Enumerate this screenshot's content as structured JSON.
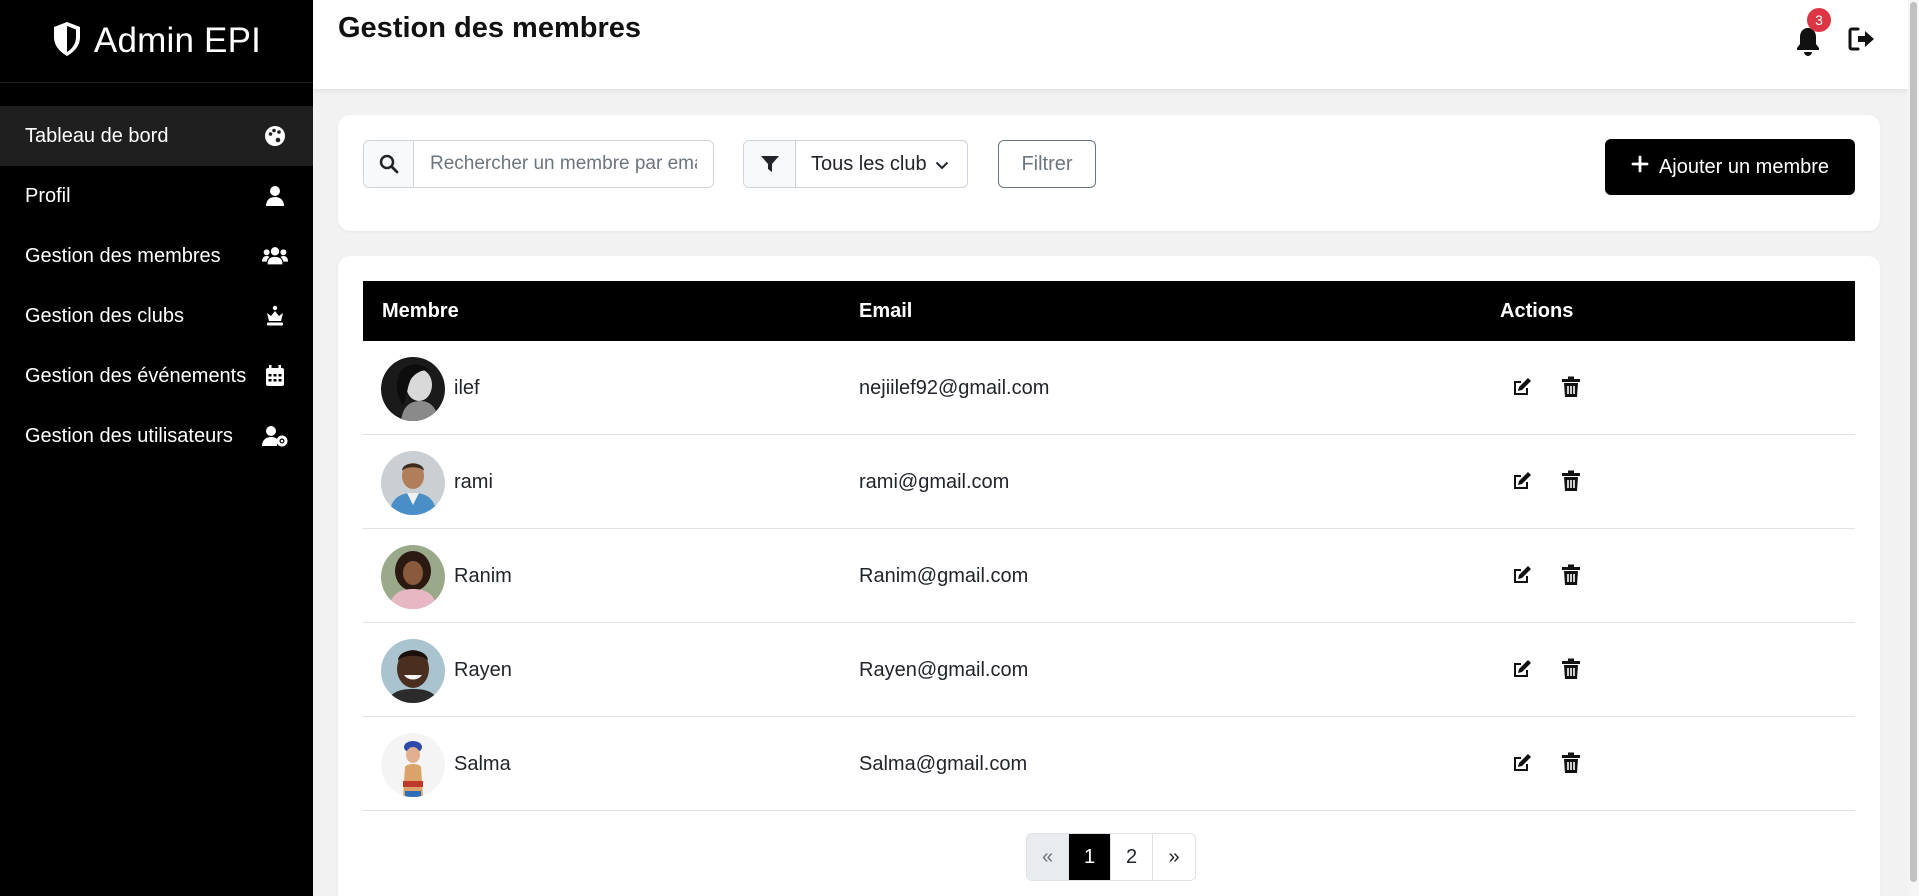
{
  "brand": {
    "title": "Admin EPI"
  },
  "sidebar": {
    "items": [
      {
        "label": "Tableau de bord",
        "icon": "palette-icon",
        "active": true
      },
      {
        "label": "Profil",
        "icon": "user-icon"
      },
      {
        "label": "Gestion des membres",
        "icon": "users-icon"
      },
      {
        "label": "Gestion des clubs",
        "icon": "chess-queen-icon"
      },
      {
        "label": "Gestion des événements",
        "icon": "calendar-icon"
      },
      {
        "label": "Gestion des utilisateurs",
        "icon": "user-gear-icon"
      }
    ]
  },
  "header": {
    "title": "Gestion des membres",
    "notifications_count": "3"
  },
  "toolbar": {
    "search_placeholder": "Rechercher un membre par email",
    "club_select": "Tous les club",
    "filter_label": "Filtrer",
    "add_label": "Ajouter un membre"
  },
  "table": {
    "headers": {
      "member": "Membre",
      "email": "Email",
      "actions": "Actions"
    },
    "rows": [
      {
        "name": "ilef",
        "email": "nejiilef92@gmail.com"
      },
      {
        "name": "rami",
        "email": "rami@gmail.com"
      },
      {
        "name": "Ranim",
        "email": "Ranim@gmail.com"
      },
      {
        "name": "Rayen",
        "email": "Rayen@gmail.com"
      },
      {
        "name": "Salma",
        "email": "Salma@gmail.com"
      }
    ]
  },
  "pagination": {
    "prev": "«",
    "pages": [
      "1",
      "2"
    ],
    "current": "1",
    "next": "»"
  },
  "colors": {
    "sidebar_bg": "#000000",
    "accent": "#000000",
    "badge": "#dc3545",
    "page_bg": "#f2f2f2"
  }
}
